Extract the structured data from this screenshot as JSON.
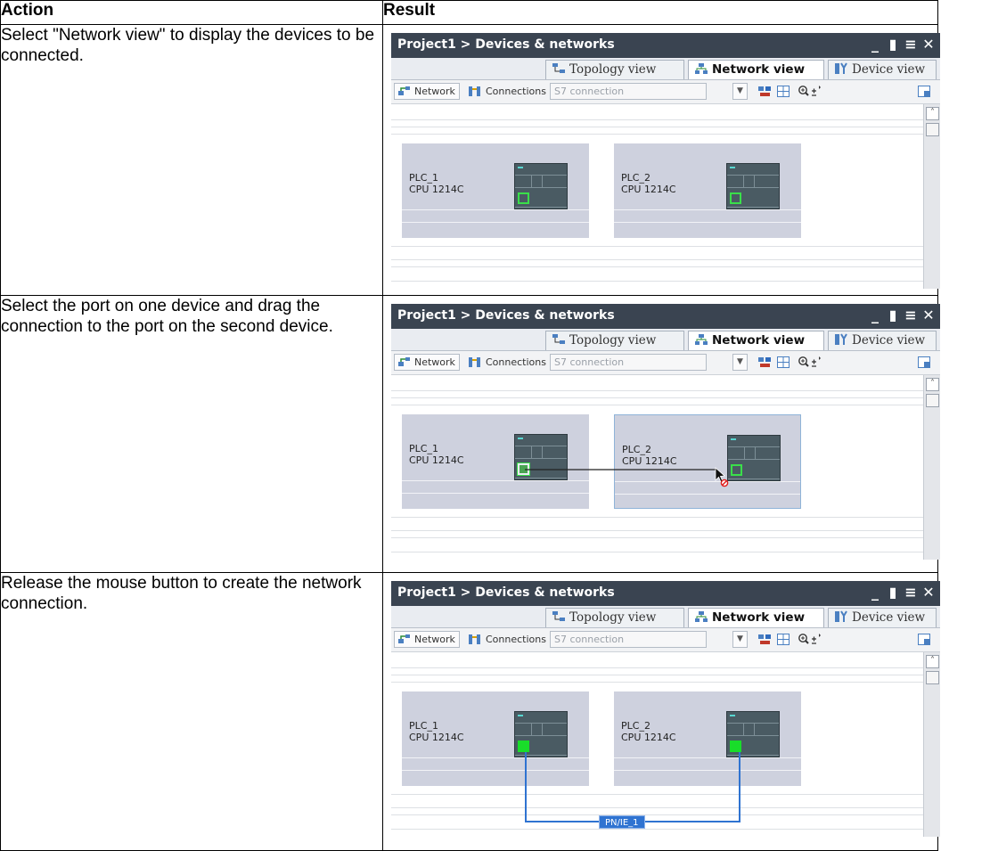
{
  "table": {
    "header_action": "Action",
    "header_result": "Result"
  },
  "steps": [
    {
      "action": "Select \"Network view\" to display the devices to be connected."
    },
    {
      "action": "Select the port on one device and drag the connection to the port on the second device."
    },
    {
      "action": "Release the mouse button to create the network connection."
    }
  ],
  "window": {
    "title": "Project1 > Devices & networks",
    "tabs": [
      "Topology view",
      "Network view",
      "Device view"
    ],
    "toolbar": {
      "network_label": "Network",
      "connections_label": "Connections",
      "connection_type": "S7 connection"
    },
    "devices": [
      {
        "name": "PLC_1",
        "cpu": "CPU 1214C"
      },
      {
        "name": "PLC_2",
        "cpu": "CPU 1214C"
      }
    ],
    "subnet_label": "PN/IE_1"
  },
  "colors": {
    "titlebar": "#3a4451",
    "device_box": "#ced1de",
    "cpu_module": "#4a5b63",
    "port_green": "#19dd2a",
    "network_line": "#2f73d1"
  }
}
